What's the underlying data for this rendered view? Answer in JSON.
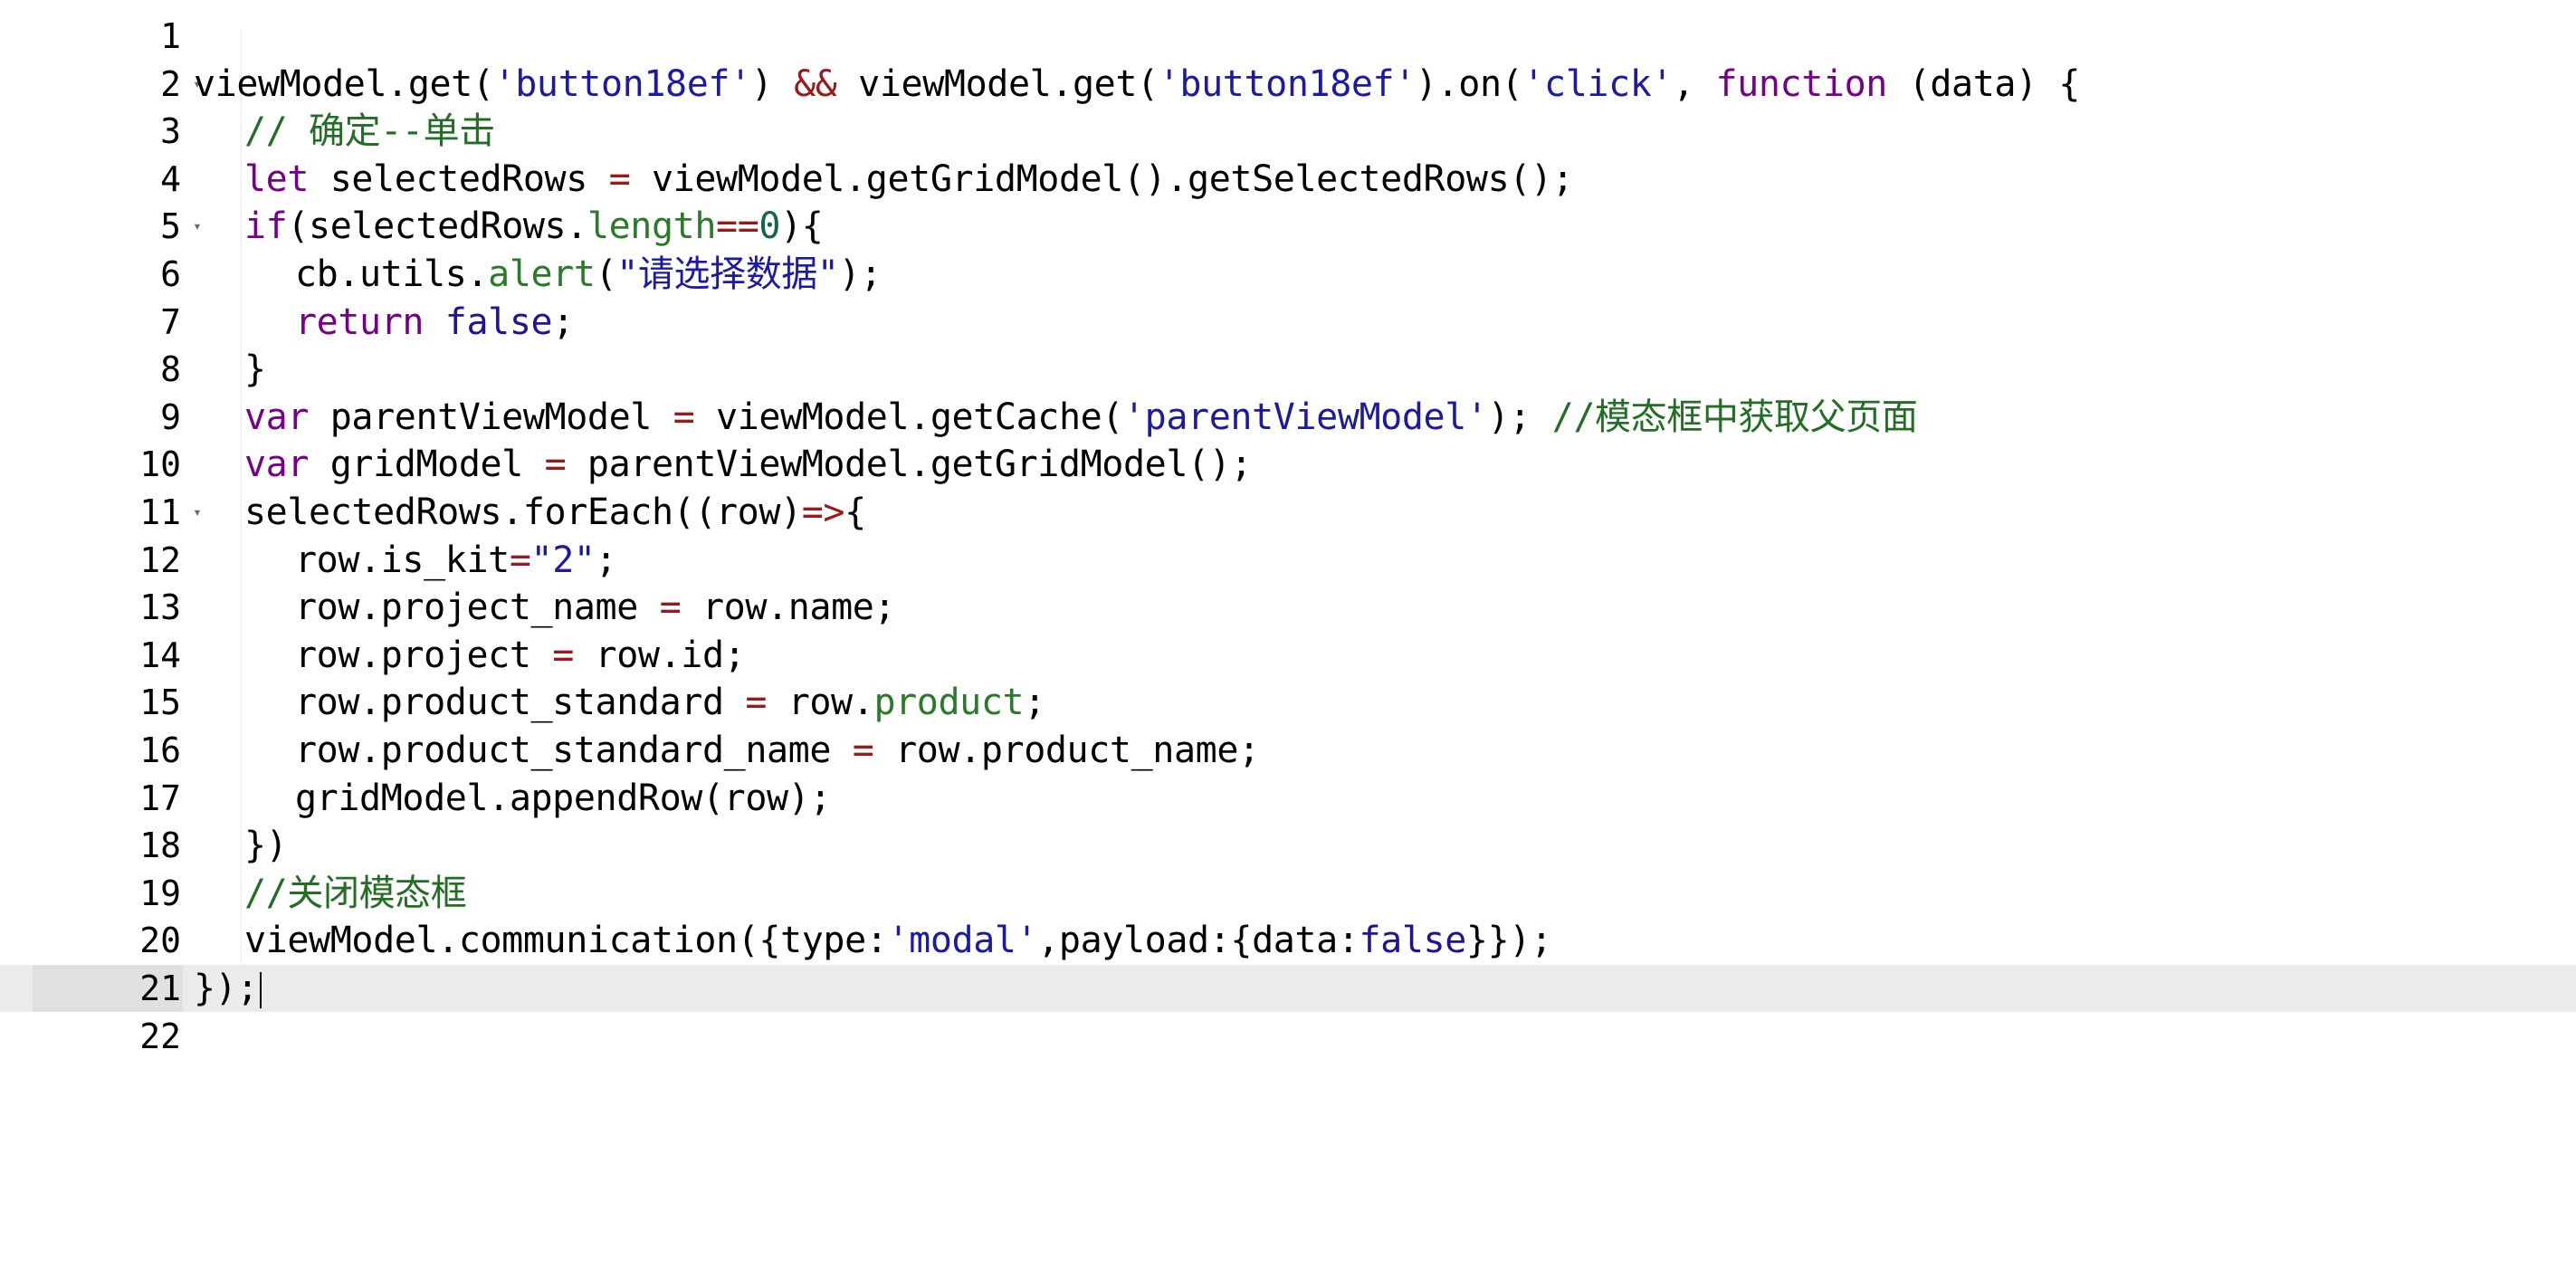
{
  "colors": {
    "default": "#000000",
    "string": "#1a1aa6",
    "comment": "#236e25",
    "keyword": "#770088",
    "atom": "#221199",
    "number": "#116644",
    "property": "#2a7a2a",
    "operator": "#981a1a",
    "line_number": "#000000",
    "active_line_bg": "#ebebeb"
  },
  "editor": {
    "active_line": 21,
    "lines": [
      {
        "n": "1",
        "fold": false,
        "indent": 0,
        "tokens": []
      },
      {
        "n": "2",
        "fold": true,
        "indent": 0,
        "tokens": [
          [
            "default",
            "viewModel.get("
          ],
          [
            "string",
            "'button18ef'"
          ],
          [
            "default",
            ") "
          ],
          [
            "operator",
            "&&"
          ],
          [
            "default",
            " viewModel.get("
          ],
          [
            "string",
            "'button18ef'"
          ],
          [
            "default",
            ").on("
          ],
          [
            "string",
            "'click'"
          ],
          [
            "default",
            ", "
          ],
          [
            "keyword",
            "function"
          ],
          [
            "default",
            " (data) {"
          ]
        ]
      },
      {
        "n": "3",
        "fold": false,
        "indent": 1,
        "tokens": [
          [
            "comment",
            "// 确定--单击"
          ]
        ]
      },
      {
        "n": "4",
        "fold": false,
        "indent": 1,
        "tokens": [
          [
            "keyword",
            "let"
          ],
          [
            "default",
            " selectedRows "
          ],
          [
            "operator",
            "="
          ],
          [
            "default",
            " viewModel.getGridModel().getSelectedRows();"
          ]
        ]
      },
      {
        "n": "5",
        "fold": true,
        "indent": 1,
        "tokens": [
          [
            "keyword",
            "if"
          ],
          [
            "default",
            "(selectedRows."
          ],
          [
            "property",
            "length"
          ],
          [
            "operator",
            "=="
          ],
          [
            "number",
            "0"
          ],
          [
            "default",
            "){"
          ]
        ]
      },
      {
        "n": "6",
        "fold": false,
        "indent": 2,
        "tokens": [
          [
            "default",
            "cb.utils."
          ],
          [
            "property",
            "alert"
          ],
          [
            "default",
            "("
          ],
          [
            "string",
            "\"请选择数据\""
          ],
          [
            "default",
            ");"
          ]
        ]
      },
      {
        "n": "7",
        "fold": false,
        "indent": 2,
        "tokens": [
          [
            "keyword",
            "return"
          ],
          [
            "default",
            " "
          ],
          [
            "atom",
            "false"
          ],
          [
            "default",
            ";"
          ]
        ]
      },
      {
        "n": "8",
        "fold": false,
        "indent": 1,
        "tokens": [
          [
            "default",
            "}"
          ]
        ]
      },
      {
        "n": "9",
        "fold": false,
        "indent": 1,
        "tokens": [
          [
            "keyword",
            "var"
          ],
          [
            "default",
            " parentViewModel "
          ],
          [
            "operator",
            "="
          ],
          [
            "default",
            " viewModel.getCache("
          ],
          [
            "string",
            "'parentViewModel'"
          ],
          [
            "default",
            "); "
          ],
          [
            "comment",
            "//模态框中获取父页面"
          ]
        ]
      },
      {
        "n": "10",
        "fold": false,
        "indent": 1,
        "tokens": [
          [
            "keyword",
            "var"
          ],
          [
            "default",
            " gridModel "
          ],
          [
            "operator",
            "="
          ],
          [
            "default",
            " parentViewModel.getGridModel();"
          ]
        ]
      },
      {
        "n": "11",
        "fold": true,
        "indent": 1,
        "tokens": [
          [
            "default",
            "selectedRows.forEach((row)"
          ],
          [
            "operator",
            "=>"
          ],
          [
            "default",
            "{"
          ]
        ]
      },
      {
        "n": "12",
        "fold": false,
        "indent": 2,
        "tokens": [
          [
            "default",
            "row.is_kit"
          ],
          [
            "operator",
            "="
          ],
          [
            "string",
            "\"2\""
          ],
          [
            "default",
            ";"
          ]
        ]
      },
      {
        "n": "13",
        "fold": false,
        "indent": 2,
        "tokens": [
          [
            "default",
            "row.project_name "
          ],
          [
            "operator",
            "="
          ],
          [
            "default",
            " row.name;"
          ]
        ]
      },
      {
        "n": "14",
        "fold": false,
        "indent": 2,
        "tokens": [
          [
            "default",
            "row.project "
          ],
          [
            "operator",
            "="
          ],
          [
            "default",
            " row.id;"
          ]
        ]
      },
      {
        "n": "15",
        "fold": false,
        "indent": 2,
        "tokens": [
          [
            "default",
            "row.product_standard "
          ],
          [
            "operator",
            "="
          ],
          [
            "default",
            " row."
          ],
          [
            "property",
            "product"
          ],
          [
            "default",
            ";"
          ]
        ]
      },
      {
        "n": "16",
        "fold": false,
        "indent": 2,
        "tokens": [
          [
            "default",
            "row.product_standard_name "
          ],
          [
            "operator",
            "="
          ],
          [
            "default",
            " row.product_name;"
          ]
        ]
      },
      {
        "n": "17",
        "fold": false,
        "indent": 2,
        "tokens": [
          [
            "default",
            "gridModel.appendRow(row);"
          ]
        ]
      },
      {
        "n": "18",
        "fold": false,
        "indent": 1,
        "tokens": [
          [
            "default",
            "})"
          ]
        ]
      },
      {
        "n": "19",
        "fold": false,
        "indent": 1,
        "tokens": [
          [
            "comment",
            "//关闭模态框"
          ]
        ]
      },
      {
        "n": "20",
        "fold": false,
        "indent": 1,
        "tokens": [
          [
            "default",
            "viewModel.communication({type:"
          ],
          [
            "string",
            "'modal'"
          ],
          [
            "default",
            ",payload:{data:"
          ],
          [
            "atom",
            "false"
          ],
          [
            "default",
            "}});"
          ]
        ]
      },
      {
        "n": "21",
        "fold": false,
        "indent": 0,
        "tokens": [
          [
            "default",
            "});"
          ]
        ]
      },
      {
        "n": "22",
        "fold": false,
        "indent": 0,
        "tokens": []
      }
    ]
  }
}
